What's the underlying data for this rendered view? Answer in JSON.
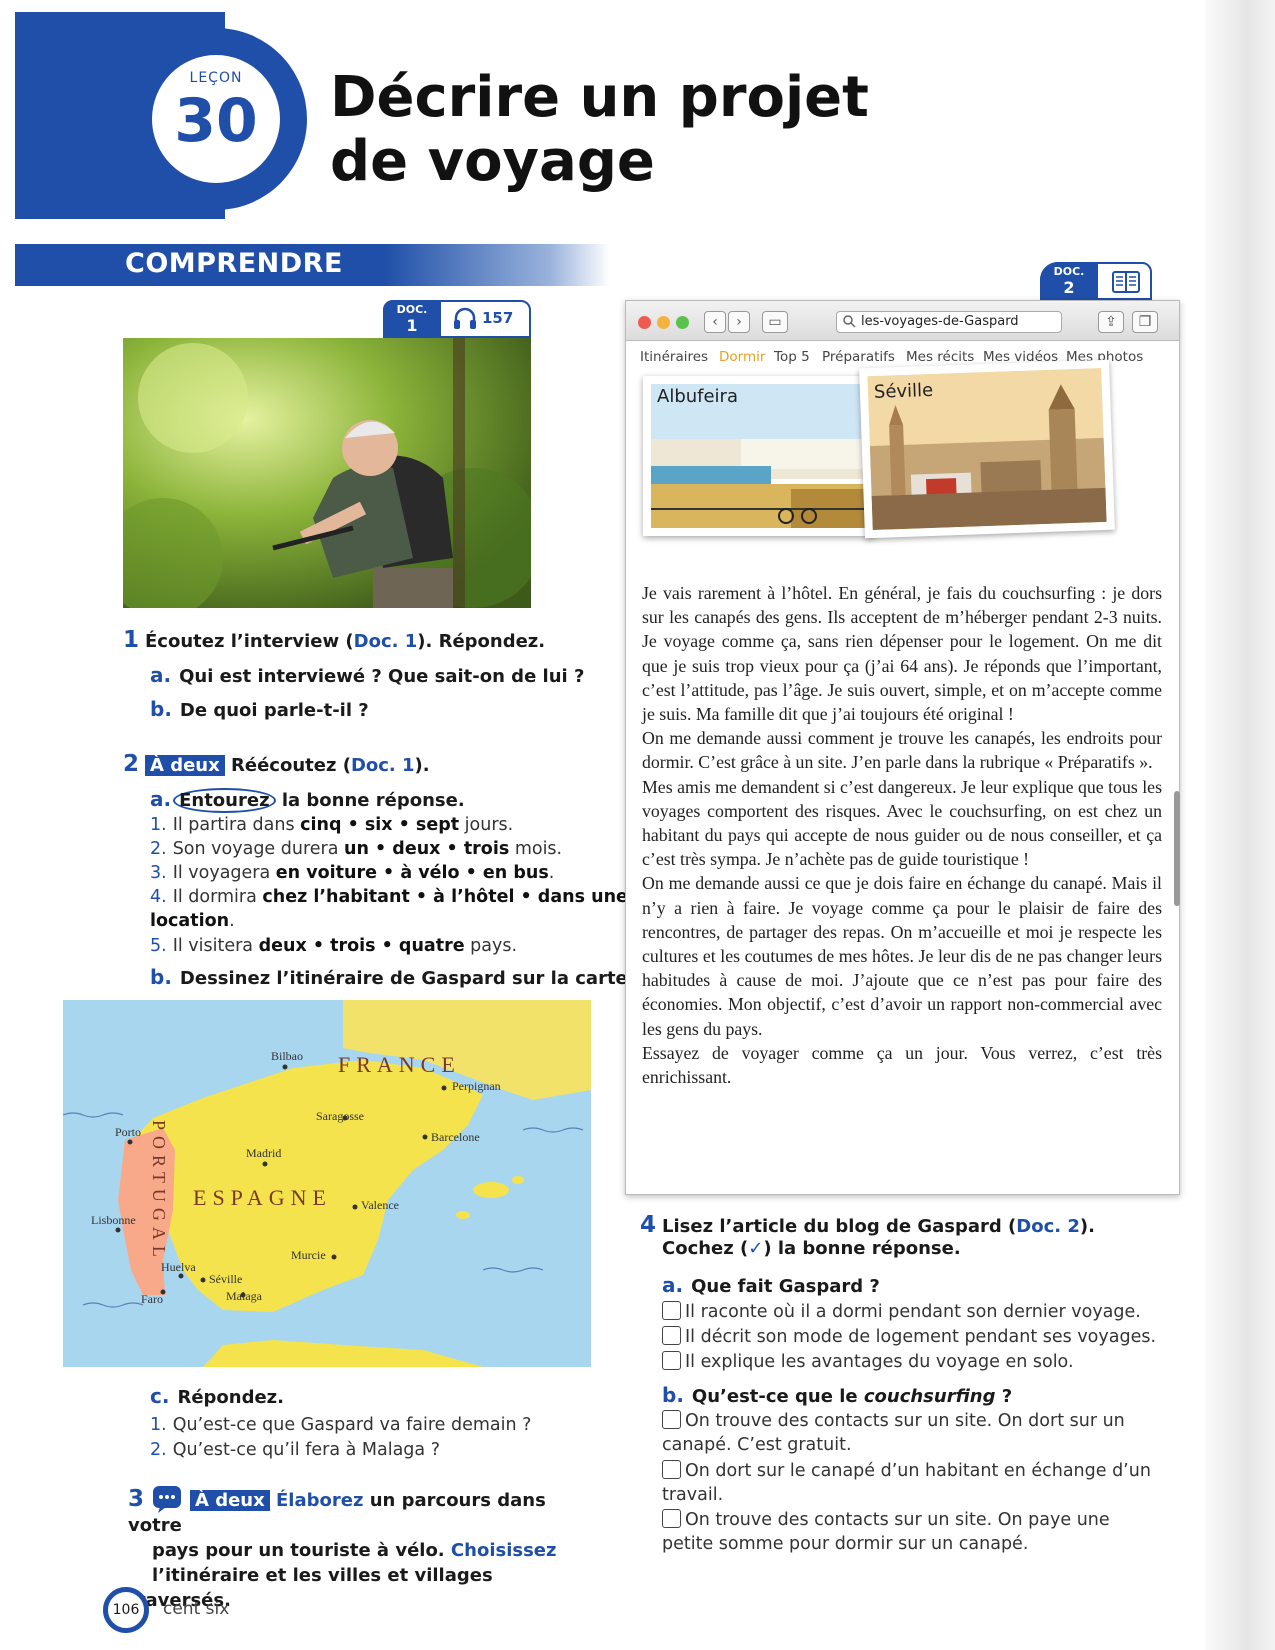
{
  "lesson": {
    "label": "LEÇON",
    "number": "30"
  },
  "title": {
    "line1": "Décrire un projet",
    "line2": "de voyage"
  },
  "section": "COMPRENDRE",
  "doc1": {
    "label": "DOC.",
    "number": "1",
    "track": "157",
    "icon": "headphones-icon"
  },
  "doc2": {
    "label": "DOC.",
    "number": "2",
    "icon": "book-icon"
  },
  "q1": {
    "number": "1",
    "text_a": "Écoutez l’interview (",
    "doc_ref": "Doc. 1",
    "text_b": "). Répondez.",
    "a_letter": "a.",
    "a": "Qui est interviewé ? Que sait-on de lui ?",
    "b_letter": "b.",
    "b": "De quoi parle-t-il ?"
  },
  "q2": {
    "number": "2",
    "tag": "À deux",
    "text_a": "Réécoutez (",
    "doc_ref": "Doc. 1",
    "text_b": ").",
    "a_letter": "a.",
    "a_circle": "Entourez",
    "a_rest": "la bonne réponse.",
    "items": [
      {
        "n": "1.",
        "pre": "Il partira dans ",
        "opts": "cinq • six • sept",
        "post": " jours."
      },
      {
        "n": "2.",
        "pre": "Son voyage durera ",
        "opts": "un • deux • trois",
        "post": " mois."
      },
      {
        "n": "3.",
        "pre": "Il voyagera ",
        "opts": "en voiture • à vélo • en bus",
        "post": "."
      },
      {
        "n": "4.",
        "pre": "Il dormira ",
        "opts": "chez l’habitant • à l’hôtel • dans une",
        "post": ""
      },
      {
        "n": "",
        "pre": "",
        "opts": "location",
        "post": "."
      },
      {
        "n": "5.",
        "pre": "Il visitera ",
        "opts": "deux • trois • quatre",
        "post": " pays."
      }
    ],
    "b_letter": "b.",
    "b": "Dessinez l’itinéraire de Gaspard sur la carte.",
    "c_letter": "c.",
    "c": "Répondez.",
    "c_items": [
      {
        "n": "1.",
        "text": "Qu’est-ce que Gaspard va faire demain ?"
      },
      {
        "n": "2.",
        "text": "Qu’est-ce qu’il fera à Malaga ?"
      }
    ]
  },
  "map": {
    "countries": [
      "FRANCE",
      "ESPAGNE",
      "PORTUGAL"
    ],
    "cities": [
      "Bilbao",
      "Perpignan",
      "Saragosse",
      "Barcelone",
      "Porto",
      "Madrid",
      "Valence",
      "Lisbonne",
      "Murcie",
      "Huelva",
      "Séville",
      "Faro",
      "Malaga"
    ]
  },
  "q3": {
    "number": "3",
    "tag": "À deux",
    "verb1": "Élaborez",
    "text1": " un parcours dans votre",
    "line2_a": "pays pour un touriste à vélo. ",
    "verb2": "Choisissez",
    "line3": "l’itinéraire et les villes et villages traversés."
  },
  "browser": {
    "url": "les-voyages-de-Gaspard",
    "menu": [
      "Itinéraires",
      "Dormir",
      "Top 5",
      "Préparatifs",
      "Mes récits",
      "Mes vidéos",
      "Mes photos"
    ],
    "active_menu": "Dormir",
    "photos": [
      "Albufeira",
      "Séville"
    ]
  },
  "article": [
    "Je vais rarement à l’hôtel. En général, je fais du couchsurfing : je dors sur les canapés des gens. Ils acceptent de m’héberger pendant 2-3 nuits. Je voyage comme ça, sans rien dépenser pour le logement. On me dit que je suis trop vieux pour ça (j’ai 64 ans). Je réponds que l’important, c’est l’attitude, pas l’âge. Je suis ouvert, simple, et on m’accepte comme je suis. Ma famille dit que j’ai toujours été original !",
    "On me demande aussi comment je trouve les canapés, les endroits pour dormir. C’est grâce à un site. J’en parle dans la rubrique « Préparatifs ».",
    "Mes amis me demandent si c’est dangereux. Je leur explique que tous les voyages comportent des risques. Avec le couchsurfing, on est chez un habitant du pays qui accepte de nous guider ou de nous conseiller, et ça c’est très sympa. Je n’achète pas de guide touristique !",
    "On me demande aussi ce que je dois faire en échange du canapé. Mais il n’y a rien à faire. Je voyage comme ça pour le plaisir de faire des rencontres, de partager des repas. On m’accueille et moi je respecte les cultures et les coutumes de mes hôtes. Je leur dis de ne pas changer leurs habitudes à cause de moi. J’ajoute que ce n’est pas pour faire des économies. Mon objectif, c’est d’avoir un rapport non-commercial avec les gens du pays.",
    "Essayez de voyager comme ça un jour. Vous verrez, c’est très enrichissant."
  ],
  "q4": {
    "number": "4",
    "line1_a": "Lisez l’article du blog de Gaspard (",
    "doc_ref": "Doc. 2",
    "line1_b": ").",
    "line2_a": "Cochez (",
    "check": "✓",
    "line2_b": ") la bonne réponse.",
    "a_letter": "a.",
    "a": "Que fait Gaspard ?",
    "a_opts": [
      "Il raconte où il a dormi pendant son dernier voyage.",
      "Il décrit son mode de logement pendant ses voyages.",
      "Il explique les avantages du voyage en solo."
    ],
    "b_letter": "b.",
    "b_pre": "Qu’est-ce que le ",
    "b_em": "couchsurfing",
    "b_post": " ?",
    "b_opts": [
      {
        "l1": "On trouve des contacts sur un site. On dort sur un",
        "l2": "canapé. C’est gratuit."
      },
      {
        "l1": "On dort sur le canapé d’un habitant en échange d’un",
        "l2": "travail."
      },
      {
        "l1": "On trouve des contacts sur un site. On paye une",
        "l2": "petite somme pour dormir sur un canapé."
      }
    ]
  },
  "footer": {
    "page_number": "106",
    "page_words": "cent six"
  },
  "colors": {
    "brand_blue": "#1f4fa8",
    "active_menu": "#e6a21b",
    "map_land": "#f4e34c",
    "map_sea": "#a9d6ef"
  }
}
